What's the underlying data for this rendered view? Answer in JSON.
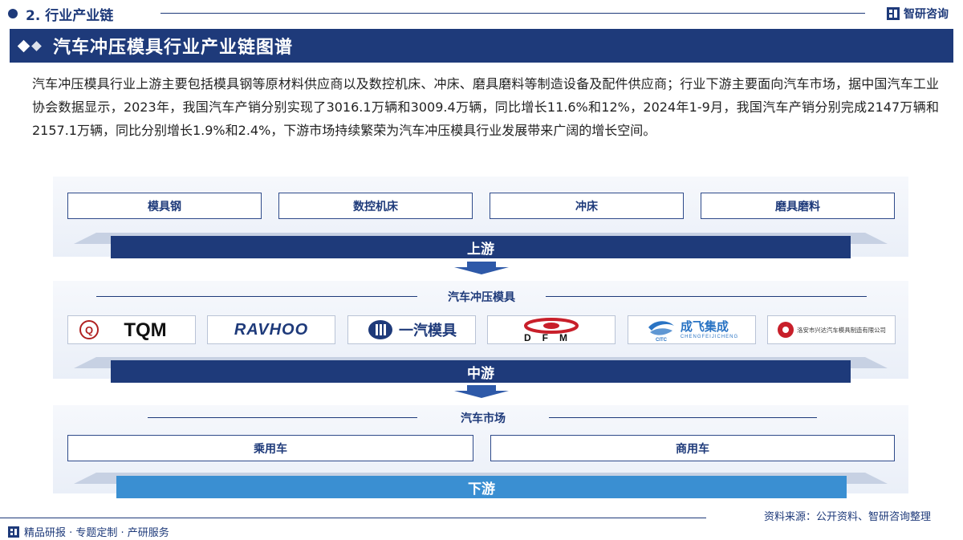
{
  "section": {
    "title": "2. 行业产业链"
  },
  "brand": {
    "name": "智研咨询"
  },
  "header": {
    "title": "汽车冲压模具行业产业链图谱"
  },
  "intro": "汽车冲压模具行业上游主要包括模具钢等原材料供应商以及数控机床、冲床、磨具磨料等制造设备及配件供应商；行业下游主要面向汽车市场，据中国汽车工业协会数据显示，2023年，我国汽车产销分别实现了3016.1万辆和3009.4万辆，同比增长11.6%和12%，2024年1-9月，我国汽车产销分别完成2147万辆和2157.1万辆，同比分别增长1.9%和2.4%，下游市场持续繁荣为汽车冲压模具行业发展带来广阔的增长空间。",
  "upstream": {
    "items": [
      "模具钢",
      "数控机床",
      "冲床",
      "磨具磨料"
    ],
    "stage_label": "上游"
  },
  "midstream": {
    "title": "汽车冲压模具",
    "companies": [
      {
        "name": "TQM",
        "icon": "tqm-logo"
      },
      {
        "name": "RAVHOO",
        "icon": "ravhoo-logo"
      },
      {
        "name": "一汽模具",
        "icon": "faw-mould-logo"
      },
      {
        "name": "DFM",
        "icon": "dfm-logo"
      },
      {
        "name": "成飞集成",
        "sub": "CHENGFEIJICHENG",
        "icon": "cfjc-logo"
      },
      {
        "name": "洛安市兴达汽车模具制造有限公司",
        "icon": "xingda-logo"
      }
    ],
    "stage_label": "中游"
  },
  "downstream": {
    "title": "汽车市场",
    "items": [
      "乘用车",
      "商用车"
    ],
    "stage_label": "下游"
  },
  "footer": {
    "source": "资料来源：公开资料、智研咨询整理",
    "tagline": "精品研报 · 专题定制 · 产研服务"
  },
  "colors": {
    "primary": "#1e3a7a",
    "accent": "#3a8fd2"
  }
}
